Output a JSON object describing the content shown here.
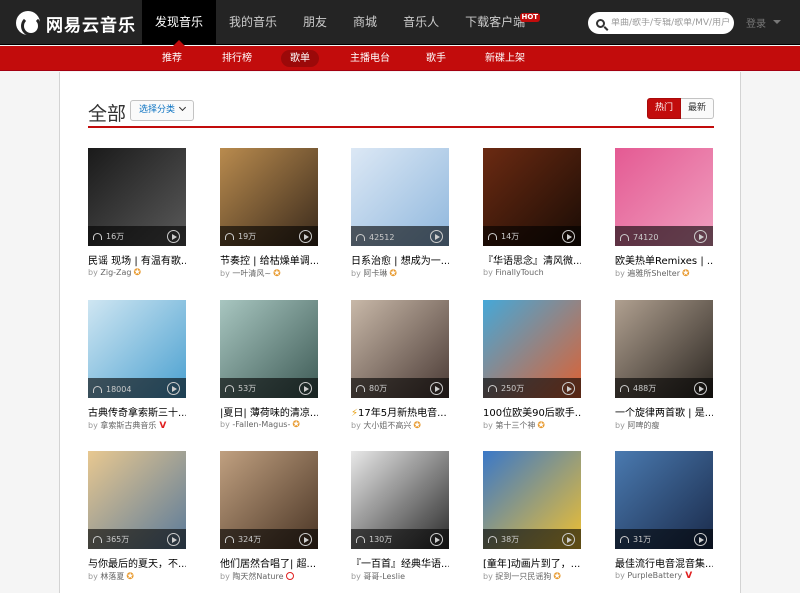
{
  "app": {
    "title": "网易云音乐"
  },
  "nav": {
    "items": [
      {
        "label": "发现音乐",
        "active": true
      },
      {
        "label": "我的音乐"
      },
      {
        "label": "朋友"
      },
      {
        "label": "商城"
      },
      {
        "label": "音乐人"
      },
      {
        "label": "下载客户端",
        "badge": "HOT"
      }
    ]
  },
  "search": {
    "placeholder": "单曲/歌手/专辑/歌单/MV/用户"
  },
  "login": {
    "label": "登录"
  },
  "subnav": {
    "items": [
      {
        "label": "推荐"
      },
      {
        "label": "排行榜"
      },
      {
        "label": "歌单",
        "active": true
      },
      {
        "label": "主播电台"
      },
      {
        "label": "歌手"
      },
      {
        "label": "新碟上架"
      }
    ]
  },
  "page": {
    "title": "全部",
    "category_button": "选择分类",
    "sort": {
      "hot": "热门",
      "new": "最新"
    }
  },
  "playlists": [
    {
      "title": "民谣 现场 | 有温有歌...",
      "by": "by",
      "author": "Zig-Zag",
      "badge": "star",
      "plays": "16万",
      "colors": [
        "#1a1a1a",
        "#5a5a5a"
      ]
    },
    {
      "title": "节奏控 | 给枯燥单调...",
      "by": "by",
      "author": "一叶清风~",
      "badge": "star",
      "plays": "19万",
      "colors": [
        "#b98b4e",
        "#3a2a1c"
      ]
    },
    {
      "title": "日系治愈 | 想成为一...",
      "by": "by",
      "author": "阿卡琳",
      "badge": "star",
      "plays": "42512",
      "colors": [
        "#dce8f5",
        "#8fb7dd"
      ]
    },
    {
      "title": "『华语思念』清风微...",
      "by": "by",
      "author": "FinallyTouch",
      "badge": "",
      "plays": "14万",
      "colors": [
        "#6b2a12",
        "#1a0c05"
      ]
    },
    {
      "title": "欧美热单Remixes | ...",
      "by": "by",
      "author": "遍雅所Shelter",
      "badge": "star",
      "plays": "74120",
      "colors": [
        "#e45a93",
        "#f0a0c0"
      ]
    },
    {
      "title": "古典传奇拿索斯三十...",
      "by": "by",
      "author": "拿索斯古典音乐",
      "badge": "v",
      "plays": "18004",
      "colors": [
        "#cfe6f2",
        "#4aa0d0"
      ]
    },
    {
      "title": "|夏日| 薄荷味的清凉...",
      "by": "by",
      "author": "-Fallen-Magus-",
      "badge": "star",
      "plays": "53万",
      "colors": [
        "#a8c6c0",
        "#3d5a55"
      ]
    },
    {
      "title": "17年5月新热电音...",
      "by": "by",
      "author": "大小姐不高兴",
      "badge": "star",
      "plays": "80万",
      "colors": [
        "#c8b8a8",
        "#4a3a35"
      ],
      "bolt": true
    },
    {
      "title": "100位欧美90后歌手...",
      "by": "by",
      "author": "第十三个神",
      "badge": "star",
      "plays": "250万",
      "colors": [
        "#45a8d8",
        "#e06030"
      ]
    },
    {
      "title": "一个旋律两首歌 | 是...",
      "by": "by",
      "author": "阿啤的瘦",
      "badge": "",
      "plays": "488万",
      "colors": [
        "#b0a090",
        "#2a2520"
      ]
    },
    {
      "title": "与你最后的夏天，不...",
      "by": "by",
      "author": "林落夏",
      "badge": "star",
      "plays": "365万",
      "colors": [
        "#e8c890",
        "#5a7a9a"
      ]
    },
    {
      "title": "他们居然合唱了| 超...",
      "by": "by",
      "author": "陶天然Nature",
      "badge": "circle",
      "plays": "324万",
      "colors": [
        "#c0a080",
        "#4a3525"
      ]
    },
    {
      "title": "『一百首』经典华语...",
      "by": "by",
      "author": "哥哥-Leslie",
      "badge": "",
      "plays": "130万",
      "colors": [
        "#e8e8e8",
        "#2a2a2a"
      ]
    },
    {
      "title": "[童年]动画片到了，...",
      "by": "by",
      "author": "捉到一只民谣狗",
      "badge": "star",
      "plays": "38万",
      "colors": [
        "#3a78c8",
        "#f0c030"
      ]
    },
    {
      "title": "最佳流行电音混音集...",
      "by": "by",
      "author": "PurpleBattery",
      "badge": "v",
      "plays": "31万",
      "colors": [
        "#4a7ab0",
        "#1a2a4a"
      ]
    }
  ]
}
